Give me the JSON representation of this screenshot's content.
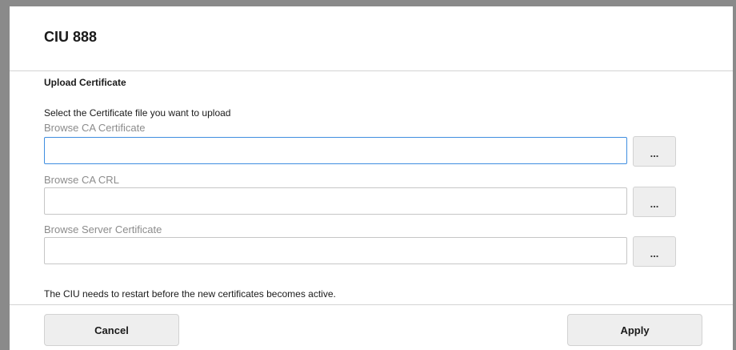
{
  "dialog": {
    "title": "CIU 888"
  },
  "upload": {
    "section_title": "Upload Certificate",
    "instruction": "Select the Certificate file you want to upload",
    "fields": [
      {
        "label": "Browse CA Certificate",
        "value": "",
        "browse_label": "..."
      },
      {
        "label": "Browse CA CRL",
        "value": "",
        "browse_label": "..."
      },
      {
        "label": "Browse Server Certificate",
        "value": "",
        "browse_label": "..."
      }
    ],
    "notice": "The CIU needs to restart before the new certificates becomes active."
  },
  "footer": {
    "cancel_label": "Cancel",
    "apply_label": "Apply"
  },
  "colors": {
    "focus_border": "#3f8ee0",
    "label_gray": "#8c8c8c",
    "button_bg": "#eeeeee"
  }
}
